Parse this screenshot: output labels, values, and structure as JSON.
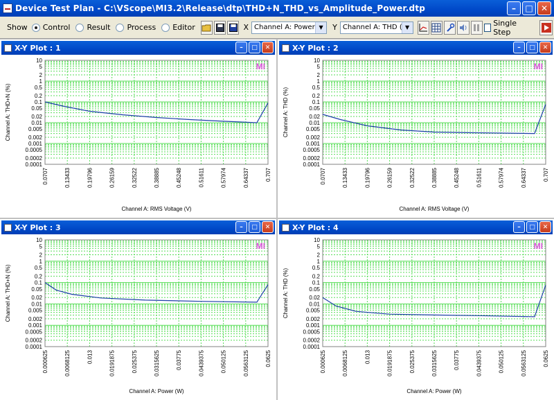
{
  "window_title": "Device Test Plan - C:\\VScope\\MI3.2\\Release\\dtp\\THD+N_THD_vs_Amplitude_Power.dtp",
  "toolbar": {
    "show_label": "Show",
    "modes": [
      {
        "label": "Control",
        "selected": true
      },
      {
        "label": "Result",
        "selected": false
      },
      {
        "label": "Process",
        "selected": false
      },
      {
        "label": "Editor",
        "selected": false
      }
    ],
    "x_label": "X",
    "x_channel": "Channel A: Power (W)",
    "y_label": "Y",
    "y_channel": "Channel A: THD (%)",
    "single_step_label": "Single Step",
    "single_step_checked": false
  },
  "watermark": "MI",
  "plots": [
    {
      "title": "X-Y Plot : 1",
      "xlabel": "Channel A: RMS Voltage (V)",
      "ylabel": "Channel A: THD+N (%)",
      "x_ticks": [
        "0.0707",
        "0.13433",
        "0.19796",
        "0.26159",
        "0.32522",
        "0.38885",
        "0.45248",
        "0.51611",
        "0.57974",
        "0.64337",
        "0.707"
      ],
      "y_ticks": [
        "10",
        "5",
        "2",
        "1",
        "0.5",
        "0.2",
        "0.1",
        "0.05",
        "0.02",
        "0.01",
        "0.005",
        "0.002",
        "0.001",
        "0.0005",
        "0.0002",
        "0.0001"
      ]
    },
    {
      "title": "X-Y Plot : 2",
      "xlabel": "Channel A: RMS Voltage (V)",
      "ylabel": "Channel A: THD (%)",
      "x_ticks": [
        "0.0707",
        "0.13433",
        "0.19796",
        "0.26159",
        "0.32522",
        "0.38885",
        "0.45248",
        "0.51611",
        "0.57974",
        "0.64337",
        "0.707"
      ],
      "y_ticks": [
        "10",
        "5",
        "2",
        "1",
        "0.5",
        "0.2",
        "0.1",
        "0.05",
        "0.02",
        "0.01",
        "0.005",
        "0.002",
        "0.001",
        "0.0005",
        "0.0002",
        "0.0001"
      ]
    },
    {
      "title": "X-Y Plot : 3",
      "xlabel": "Channel A: Power (W)",
      "ylabel": "Channel A: THD+N (%)",
      "x_ticks": [
        "0.000625",
        "0.0068125",
        "0.013",
        "0.0191875",
        "0.025375",
        "0.0315625",
        "0.03775",
        "0.0439375",
        "0.050125",
        "0.0563125",
        "0.0625"
      ],
      "y_ticks": [
        "10",
        "5",
        "2",
        "1",
        "0.5",
        "0.2",
        "0.1",
        "0.05",
        "0.02",
        "0.01",
        "0.005",
        "0.002",
        "0.001",
        "0.0005",
        "0.0002",
        "0.0001"
      ]
    },
    {
      "title": "X-Y Plot : 4",
      "xlabel": "Channel A: Power (W)",
      "ylabel": "Channel A: THD (%)",
      "x_ticks": [
        "0.000625",
        "0.0068125",
        "0.013",
        "0.0191875",
        "0.025375",
        "0.0315625",
        "0.03775",
        "0.0439375",
        "0.050125",
        "0.0563125",
        "0.0625"
      ],
      "y_ticks": [
        "10",
        "5",
        "2",
        "1",
        "0.5",
        "0.2",
        "0.1",
        "0.05",
        "0.02",
        "0.01",
        "0.005",
        "0.002",
        "0.001",
        "0.0005",
        "0.0002",
        "0.0001"
      ]
    }
  ],
  "colors": {
    "grid": "#55dd55",
    "curve": "#1d3fa8",
    "watermark": "#dd55dd",
    "titlebar": "#0048c8"
  }
}
